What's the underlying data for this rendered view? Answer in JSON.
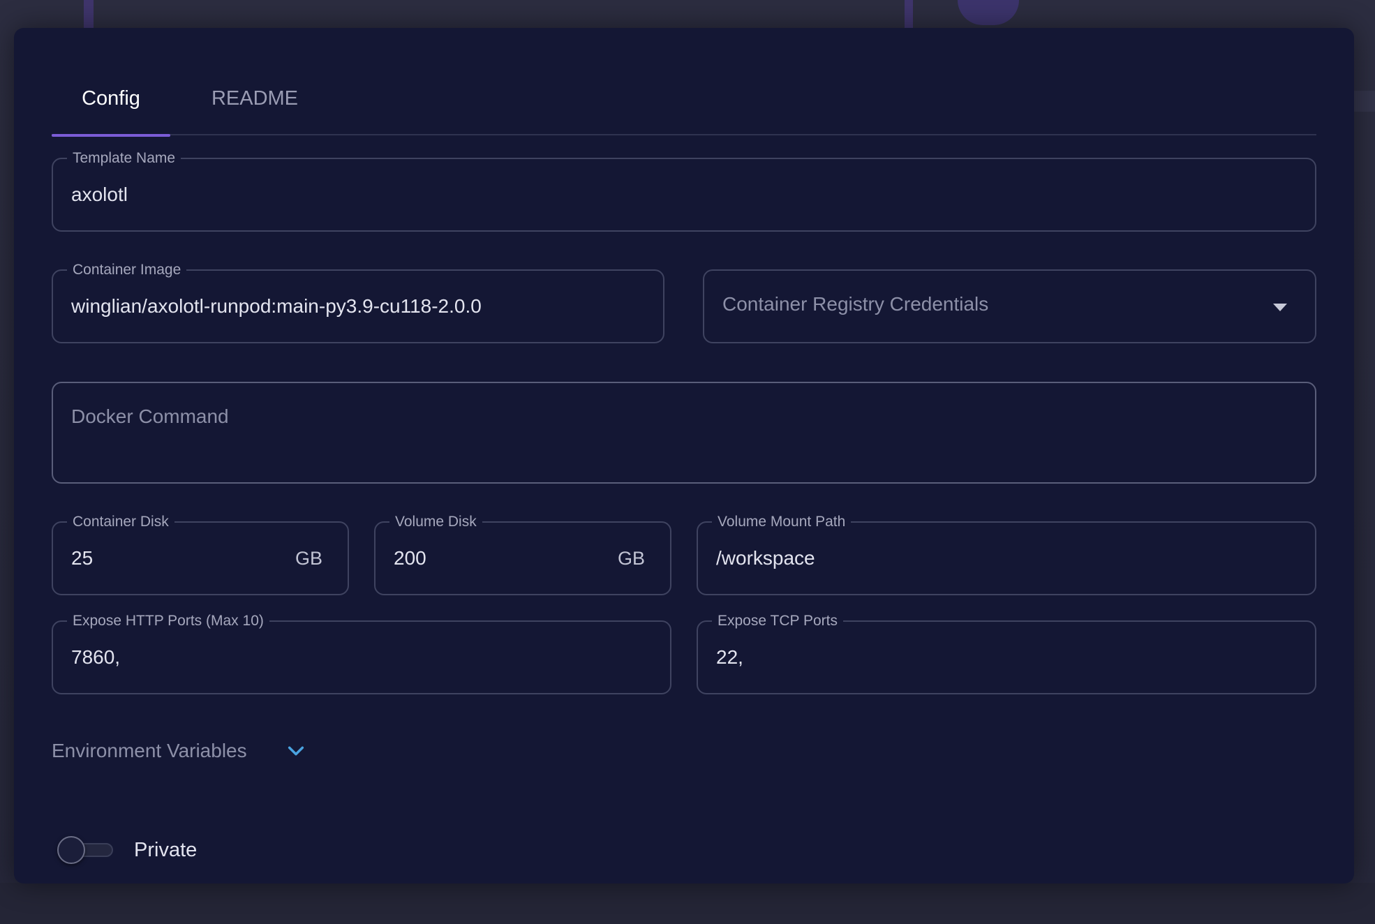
{
  "tabs": [
    {
      "label": "Config",
      "active": true
    },
    {
      "label": "README",
      "active": false
    }
  ],
  "form": {
    "template_name": {
      "label": "Template Name",
      "value": "axolotl"
    },
    "container_image": {
      "label": "Container Image",
      "value": "winglian/axolotl-runpod:main-py3.9-cu118-2.0.0"
    },
    "registry_credentials": {
      "placeholder": "Container Registry Credentials"
    },
    "docker_command": {
      "placeholder": "Docker Command"
    },
    "container_disk": {
      "label": "Container Disk",
      "value": "25",
      "unit": "GB"
    },
    "volume_disk": {
      "label": "Volume Disk",
      "value": "200",
      "unit": "GB"
    },
    "volume_mount_path": {
      "label": "Volume Mount Path",
      "value": "/workspace"
    },
    "http_ports": {
      "label": "Expose HTTP Ports (Max 10)",
      "value": "7860,"
    },
    "tcp_ports": {
      "label": "Expose TCP Ports",
      "value": "22,"
    }
  },
  "env_section": {
    "label": "Environment Variables",
    "icon": "chevron-down-icon"
  },
  "private_toggle": {
    "label": "Private",
    "on": false
  },
  "colors": {
    "accent": "#7b5cd6",
    "chevron": "#4aa3e0",
    "panel": "#141734"
  }
}
